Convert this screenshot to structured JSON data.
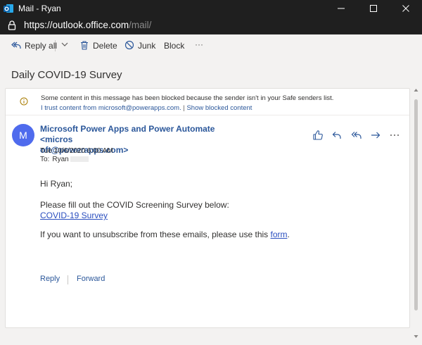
{
  "window": {
    "title": "Mail - Ryan",
    "app_icon_letter": "O",
    "controls": [
      "minimize-icon",
      "maximize-icon",
      "close-icon"
    ]
  },
  "address_bar": {
    "url_scheme_host": "https://outlook.office.com",
    "url_path": "/mail/"
  },
  "toolbar": {
    "reply_all": "Reply all",
    "delete": "Delete",
    "junk": "Junk",
    "block": "Block",
    "more": "···"
  },
  "message": {
    "subject": "Daily COVID-19 Survey",
    "notice": {
      "text": "Some content in this message has been blocked because the sender isn't in your Safe senders list.",
      "trust_link": "I trust content from microsoft@powerapps.com.",
      "separator": "|",
      "show_link": "Show blocked content"
    },
    "avatar_letter": "M",
    "sender_line1": "Microsoft Power Apps and Power Automate <micros",
    "sender_line2": "oft@powerapps.com>",
    "date": "Tue 10/6/2020 6:00 AM",
    "to_label": "To:",
    "to_name": "Ryan",
    "actions": [
      "like-icon",
      "reply-icon",
      "reply-all-icon",
      "forward-icon",
      "more-icon"
    ],
    "body": {
      "greeting": "Hi Ryan;",
      "line1": "Please fill out the COVID Screening Survey below:",
      "survey_link": "COVID-19 Survey",
      "unsub_text": "If you want to unsubscribe from these emails, please use this ",
      "form_link": "form",
      "unsub_end": "."
    },
    "reply": "Reply",
    "forward": "Forward"
  },
  "colors": {
    "chrome": "#1f1f1f",
    "accent": "#2b579a",
    "avatar": "#4f6bed",
    "link": "#2b4fbf",
    "background": "#f3f2f1"
  }
}
